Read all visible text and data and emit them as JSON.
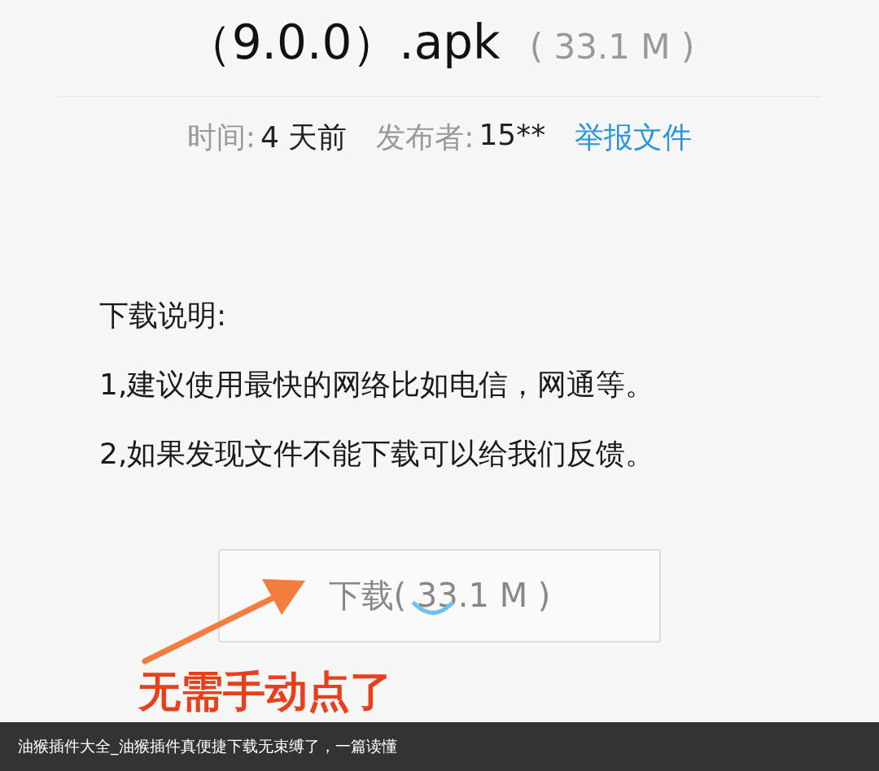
{
  "title": {
    "name": "（9.0.0）.apk",
    "size": "( 33.1 M )"
  },
  "meta": [
    {
      "label": "时间:",
      "value": "4 天前"
    },
    {
      "label": "发布者:",
      "value": "15**"
    }
  ],
  "report_link": "举报文件",
  "instructions": {
    "heading": "下载说明:",
    "lines": [
      "1,建议使用最快的网络比如电信，网通等。",
      "2,如果发现文件不能下载可以给我们反馈。"
    ]
  },
  "download_button": {
    "label": "下载(",
    "size": "33.1 M )",
    "loading": true
  },
  "annotation": "无需手动点了",
  "caption": "油猴插件大全_油猴插件真便捷下载无束缚了，一篇读懂"
}
